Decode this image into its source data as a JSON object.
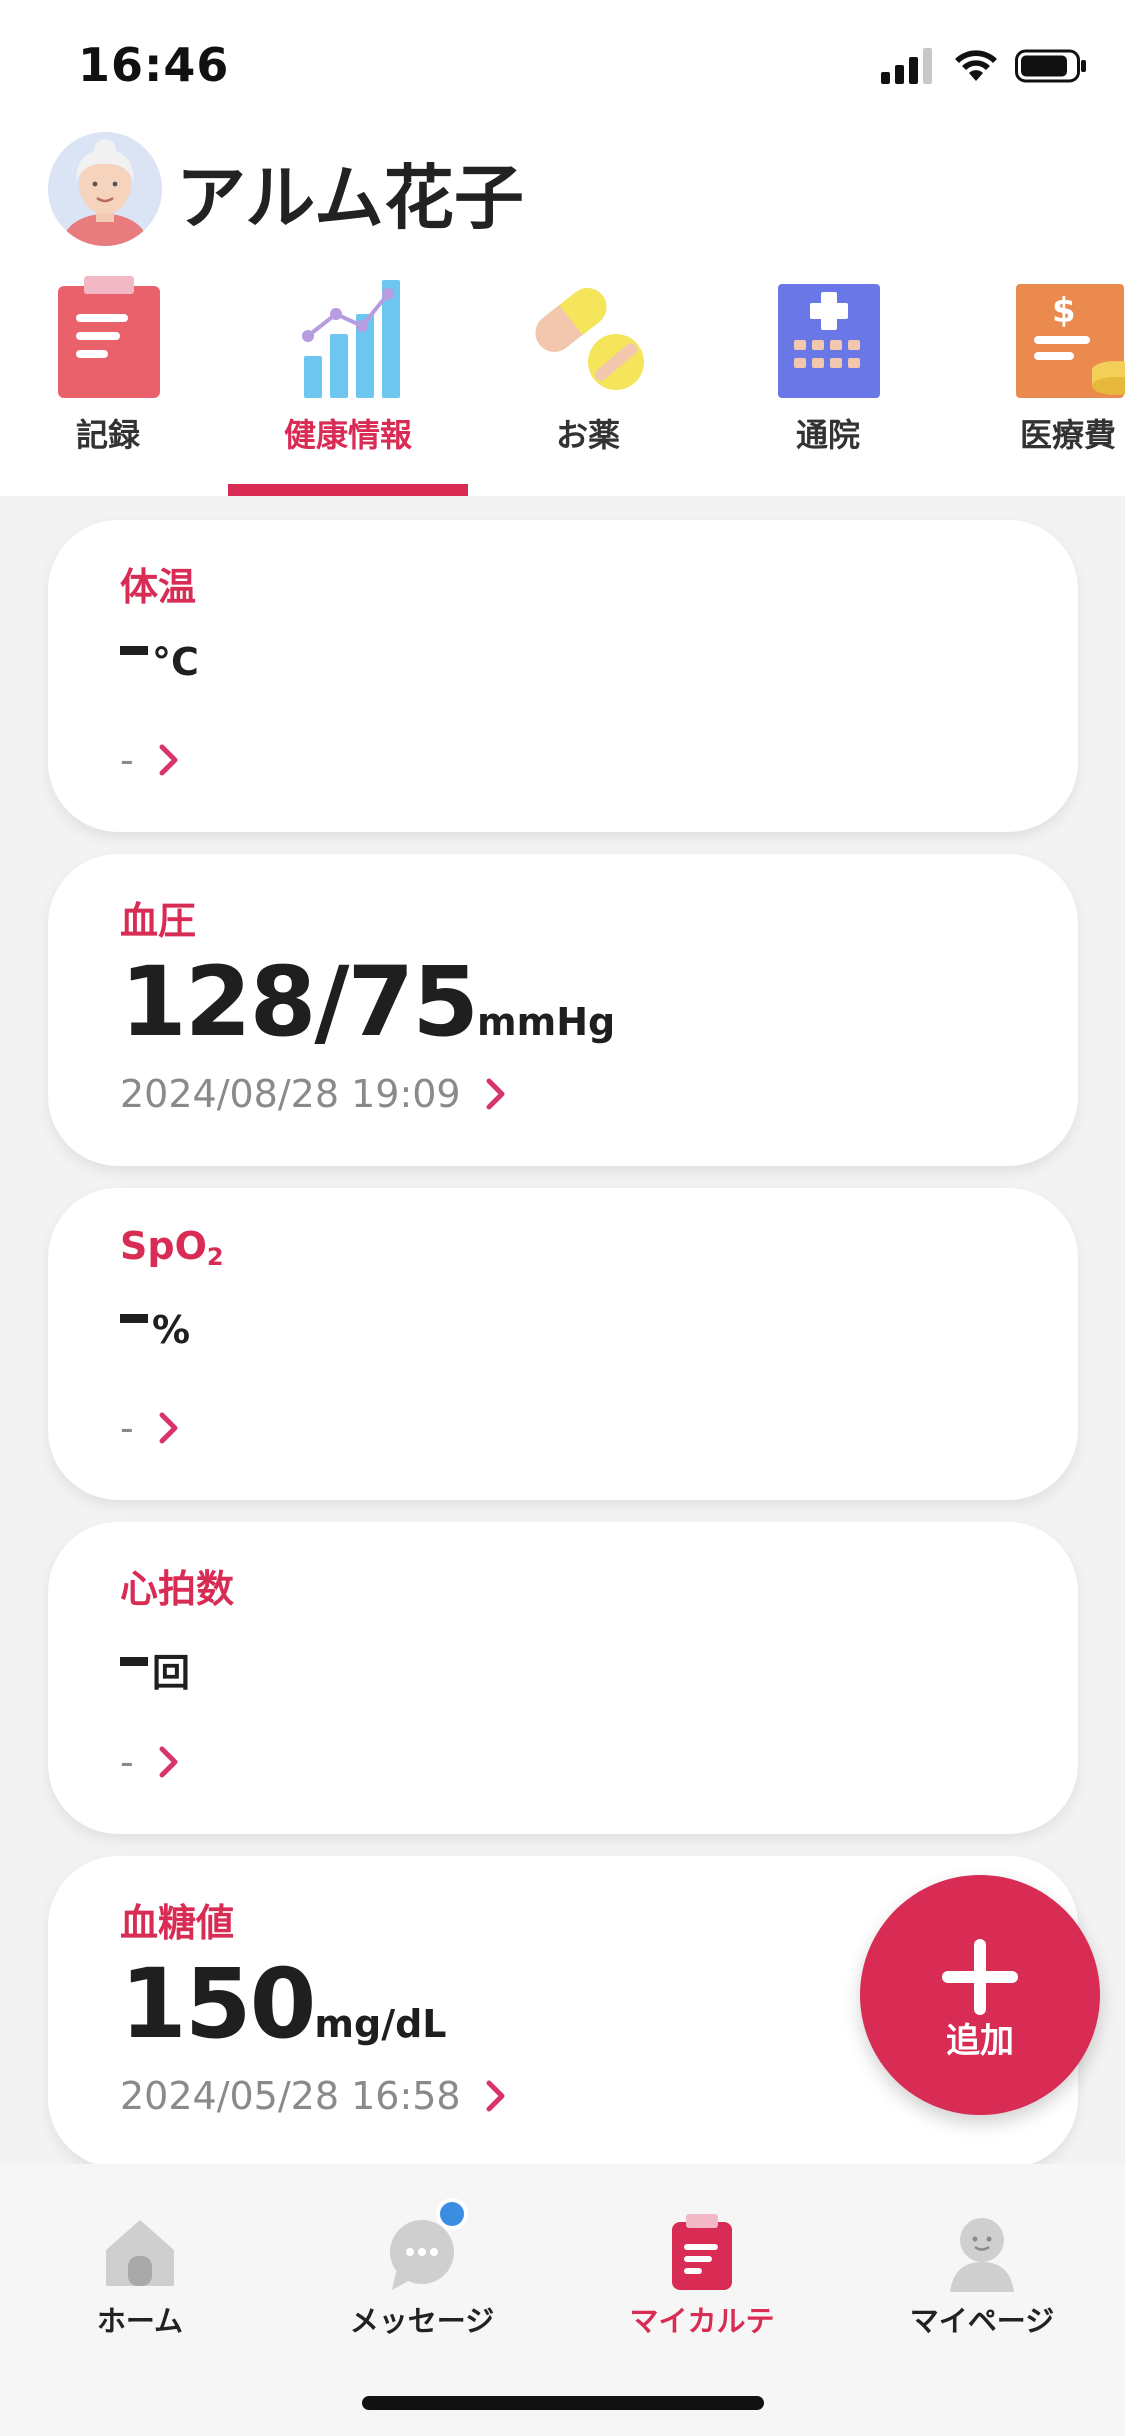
{
  "status_bar": {
    "time": "16:46"
  },
  "profile": {
    "name": "アルム花子"
  },
  "category_tabs": [
    {
      "label": "記録",
      "icon": "clipboard-icon"
    },
    {
      "label": "健康情報",
      "icon": "chart-icon",
      "active": true
    },
    {
      "label": "お薬",
      "icon": "pill-icon"
    },
    {
      "label": "通院",
      "icon": "hospital-icon"
    },
    {
      "label": "医療費",
      "icon": "medical-bill-icon"
    }
  ],
  "cards": [
    {
      "title": "体温",
      "value": "",
      "unit": "°C",
      "date": "-"
    },
    {
      "title": "血圧",
      "value": "128/75",
      "unit": "mmHg",
      "date": "2024/08/28 19:09"
    },
    {
      "title": "SpO",
      "title_sub": "2",
      "value": "",
      "unit": "%",
      "date": "-"
    },
    {
      "title": "心拍数",
      "value": "",
      "unit": "回",
      "date": "-"
    },
    {
      "title": "血糖値",
      "value": "150",
      "unit": "mg/dL",
      "date": "2024/05/28 16:58"
    }
  ],
  "fab": {
    "label": "追加"
  },
  "bottom_nav": [
    {
      "label": "ホーム",
      "icon": "home-icon"
    },
    {
      "label": "メッセージ",
      "icon": "message-icon",
      "has_badge": true
    },
    {
      "label": "マイカルテ",
      "icon": "chart-record-icon",
      "active": true
    },
    {
      "label": "マイページ",
      "icon": "person-icon"
    }
  ],
  "colors": {
    "accent": "#d82c55",
    "badge": "#3a8de0"
  }
}
